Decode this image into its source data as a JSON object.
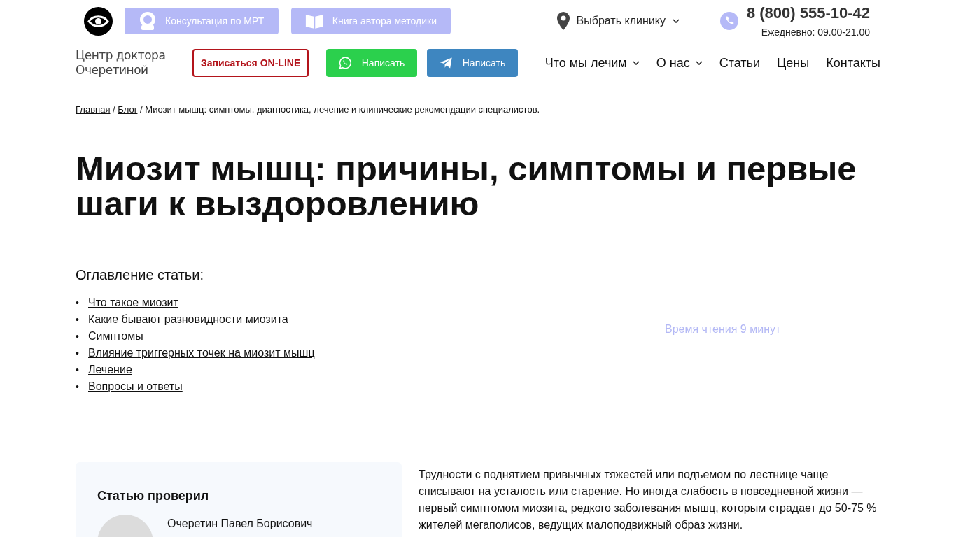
{
  "header": {
    "top_buttons": [
      {
        "kind": "mri",
        "label": "Консультация по МРТ"
      },
      {
        "kind": "book",
        "label": "Книга автора методики"
      }
    ],
    "clinic_select": {
      "label": "Выбрать клинику"
    },
    "phone": {
      "number": "8 (800) 555-10-42",
      "hours": "Ежедневно: 09.00-21.00"
    },
    "logo": [
      "Центр доктора",
      "Очеретиной"
    ],
    "actions": [
      {
        "kind": "online",
        "label": "Записаться ON-LINE"
      },
      {
        "kind": "whatsapp",
        "label": "Написать"
      },
      {
        "kind": "telegram",
        "label": "Написать"
      }
    ],
    "nav": [
      {
        "label": "Что мы лечим",
        "dropdown": true
      },
      {
        "label": "О нас",
        "dropdown": true
      },
      {
        "label": "Статьи",
        "dropdown": false
      },
      {
        "label": "Цены",
        "dropdown": false
      },
      {
        "label": "Контакты",
        "dropdown": false
      }
    ]
  },
  "breadcrumbs": {
    "separator": "/",
    "links": [
      "Главная",
      "Блог"
    ],
    "current": "Миозит мышц: симптомы, диагностика, лечение и клинические рекомендации специалистов."
  },
  "title": "Миозит мышц: причины, симптомы и первые шаги к выздоровлению",
  "toc": {
    "heading": "Оглавление статьи:",
    "bullet": "•",
    "items": [
      "Что такое миозит",
      "Какие бывают разновидности миозита",
      "Симптомы",
      "Влияние триггерных точек на миозит мышц",
      "Лечение",
      "Вопросы и ответы"
    ]
  },
  "reading_time": "Время чтения 9 минут",
  "reviewer": {
    "heading": "Статью проверил",
    "name": "Очеретин Павел Борисович"
  },
  "intro": "Трудности с поднятием привычных тяжестей или подъемом по лестнице чаще списывают на усталость или старение. Но иногда слабость в повседневной жизни — первый симптомом миозита, редкого заболевания мышц, которым страдает до 50-75 % жителей мегаполисов, ведущих малоподвижный образ жизни."
}
